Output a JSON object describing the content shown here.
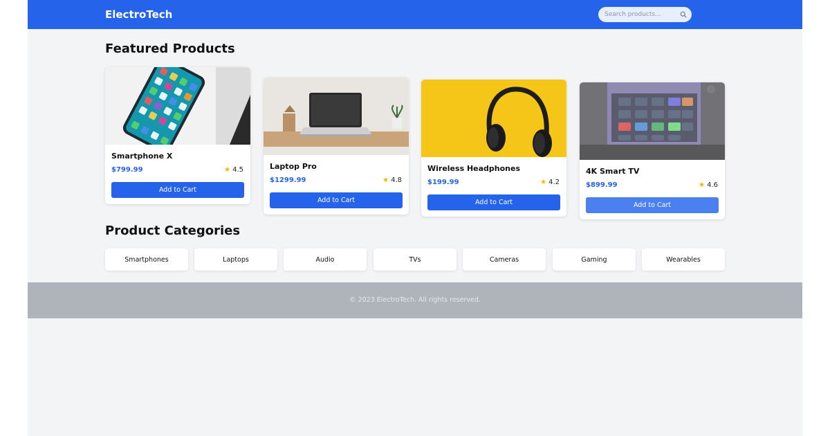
{
  "header": {
    "brand": "ElectroTech",
    "search_placeholder": "Search products..."
  },
  "colors": {
    "brand_blue": "#2563eb",
    "background": "#f3f4f6",
    "star": "#f5b400",
    "footer": "#afb3ba"
  },
  "featured": {
    "title": "Featured Products",
    "products": [
      {
        "name": "Smartphone X",
        "price": "$799.99",
        "rating": "4.5",
        "button": "Add to Cart",
        "image": "smartphone-photo"
      },
      {
        "name": "Laptop Pro",
        "price": "$1299.99",
        "rating": "4.8",
        "button": "Add to Cart",
        "image": "laptop-photo"
      },
      {
        "name": "Wireless Headphones",
        "price": "$199.99",
        "rating": "4.2",
        "button": "Add to Cart",
        "image": "headphones-photo"
      },
      {
        "name": "4K Smart TV",
        "price": "$899.99",
        "rating": "4.6",
        "button": "Add to Cart",
        "image": "smart-tv-photo"
      }
    ]
  },
  "categories": {
    "title": "Product Categories",
    "items": [
      "Smartphones",
      "Laptops",
      "Audio",
      "TVs",
      "Cameras",
      "Gaming",
      "Wearables"
    ]
  },
  "footer": {
    "text": "© 2023 ElectroTech. All rights reserved."
  }
}
